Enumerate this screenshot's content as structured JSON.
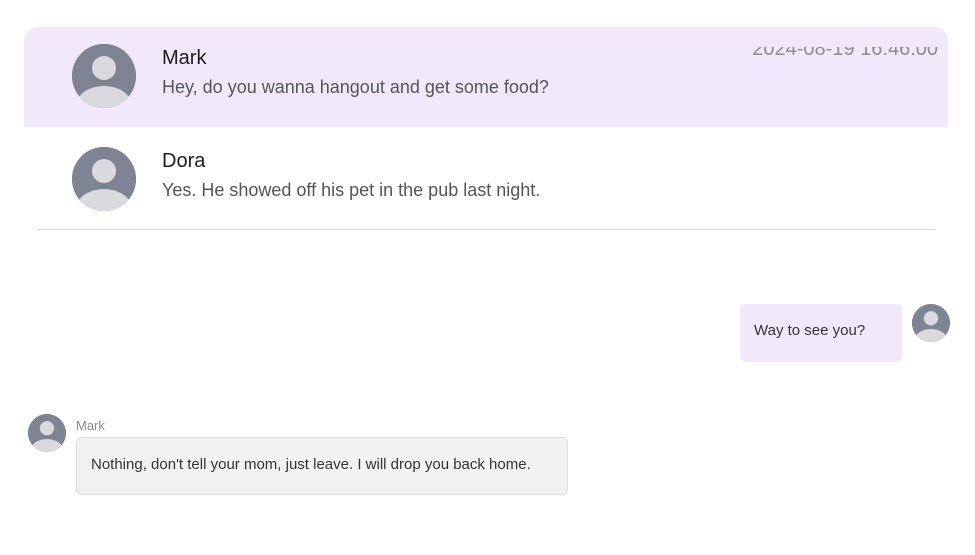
{
  "conversations": [
    {
      "name": "Mark",
      "preview": "Hey, do you wanna hangout and get some food?",
      "timestamp": "2024-08-19 16:46:00",
      "selected": true
    },
    {
      "name": "Dora",
      "preview": "Yes. He showed off his pet in the pub last night.",
      "selected": false
    }
  ],
  "messages": {
    "outgoing": {
      "text": "Way to see you?"
    },
    "incoming": {
      "sender": "Mark",
      "text": "Nothing, don't tell your mom, just leave. I will drop you back home."
    }
  },
  "colors": {
    "selected_background": "#f1e9fb",
    "outgoing_bubble": "#f1e9fb",
    "incoming_bubble": "#f2f2f2",
    "avatar_placeholder": "#7f8494"
  },
  "icons": {
    "avatar": "default-user-avatar-icon"
  }
}
